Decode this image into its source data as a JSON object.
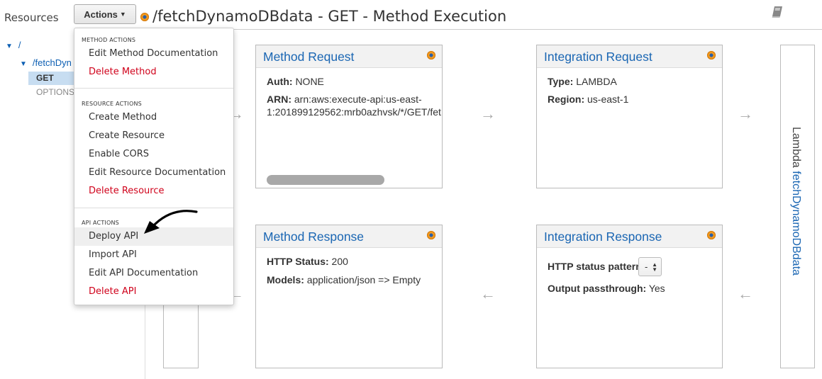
{
  "header": {
    "resources_label": "Resources",
    "actions_label": "Actions",
    "page_title": "/fetchDynamoDBdata - GET - Method Execution"
  },
  "tree": {
    "root": "/",
    "resource": "/fetchDyn",
    "get": "GET",
    "options": "OPTIONS"
  },
  "menu": {
    "method_actions_heading": "METHOD ACTIONS",
    "method_actions": [
      {
        "label": "Edit Method Documentation"
      },
      {
        "label": "Delete Method",
        "danger": true
      }
    ],
    "resource_actions_heading": "RESOURCE ACTIONS",
    "resource_actions": [
      {
        "label": "Create Method"
      },
      {
        "label": "Create Resource"
      },
      {
        "label": "Enable CORS"
      },
      {
        "label": "Edit Resource Documentation"
      },
      {
        "label": "Delete Resource",
        "danger": true
      }
    ],
    "api_actions_heading": "API ACTIONS",
    "api_actions": [
      {
        "label": "Deploy API",
        "highlighted": true
      },
      {
        "label": "Import API"
      },
      {
        "label": "Edit API Documentation"
      },
      {
        "label": "Delete API",
        "danger": true
      }
    ]
  },
  "method_request": {
    "title": "Method Request",
    "auth_label": "Auth:",
    "auth_value": "NONE",
    "arn_label": "ARN:",
    "arn_value_line1": "arn:aws:execute-api:us-east-",
    "arn_value_line2": "1:201899129562:mrb0azhvsk/*/GET/fet"
  },
  "integration_request": {
    "title": "Integration Request",
    "type_label": "Type:",
    "type_value": "LAMBDA",
    "region_label": "Region:",
    "region_value": "us-east-1"
  },
  "method_response": {
    "title": "Method Response",
    "status_label": "HTTP Status:",
    "status_value": "200",
    "models_label": "Models:",
    "models_value": "application/json => Empty"
  },
  "integration_response": {
    "title": "Integration Response",
    "pattern_label": "HTTP status pattern:",
    "pattern_value": "-",
    "passthrough_label": "Output passthrough:",
    "passthrough_value": "Yes"
  },
  "lambda": {
    "prefix": "Lambda",
    "function_name": "fetchDynamoDBdata"
  },
  "icons": {
    "status_dot": "status-dot-icon",
    "doc": "book-icon",
    "arrow_right": "→",
    "arrow_left": "←"
  },
  "colors": {
    "link": "#1a66b3",
    "danger": "#d0021b",
    "dot_orange": "#f39a1e",
    "tree_selected": "#c7ddf1"
  }
}
